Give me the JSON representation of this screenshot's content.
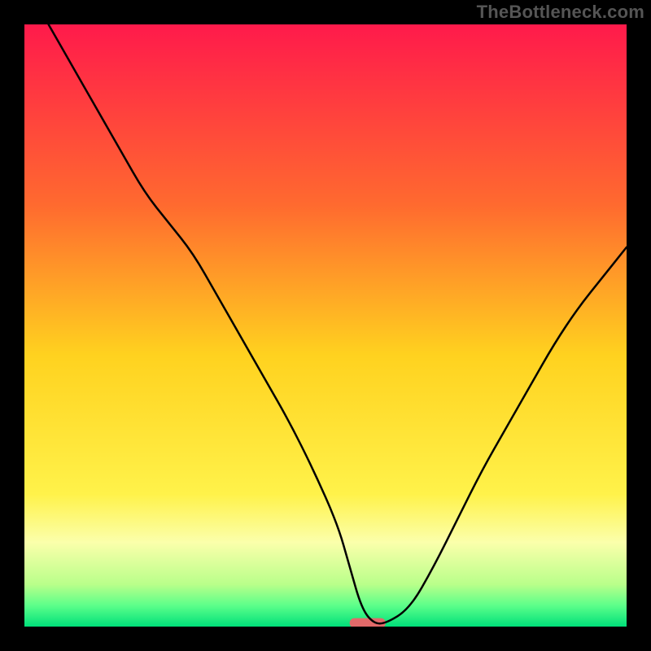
{
  "watermark": "TheBottleneck.com",
  "chart_data": {
    "type": "line",
    "title": "",
    "xlabel": "",
    "ylabel": "",
    "xlim": [
      0,
      100
    ],
    "ylim": [
      0,
      100
    ],
    "grid": false,
    "legend": false,
    "background_gradient_stops": [
      {
        "offset": 0.0,
        "color": "#ff1a4b"
      },
      {
        "offset": 0.3,
        "color": "#ff6a2f"
      },
      {
        "offset": 0.55,
        "color": "#ffd21f"
      },
      {
        "offset": 0.78,
        "color": "#fff24a"
      },
      {
        "offset": 0.86,
        "color": "#fbffab"
      },
      {
        "offset": 0.93,
        "color": "#b9ff8a"
      },
      {
        "offset": 0.965,
        "color": "#5cff8a"
      },
      {
        "offset": 1.0,
        "color": "#00e07a"
      }
    ],
    "series": [
      {
        "name": "bottleneck-curve",
        "type": "line",
        "color": "#000000",
        "x": [
          4,
          8,
          12,
          16,
          20,
          24,
          28,
          32,
          36,
          40,
          44,
          48,
          52,
          54,
          56,
          58,
          60,
          64,
          68,
          72,
          76,
          80,
          84,
          88,
          92,
          96,
          100
        ],
        "y": [
          100,
          93,
          86,
          79,
          72,
          67,
          62,
          55,
          48,
          41,
          34,
          26,
          17,
          10,
          3,
          0.5,
          0.5,
          3,
          10,
          18,
          26,
          33,
          40,
          47,
          53,
          58,
          63
        ]
      }
    ],
    "marker": {
      "name": "optimal-range",
      "shape": "capsule",
      "color": "#e26a6a",
      "x_center": 57,
      "y": 0.6,
      "width": 6,
      "height": 1.6
    }
  }
}
